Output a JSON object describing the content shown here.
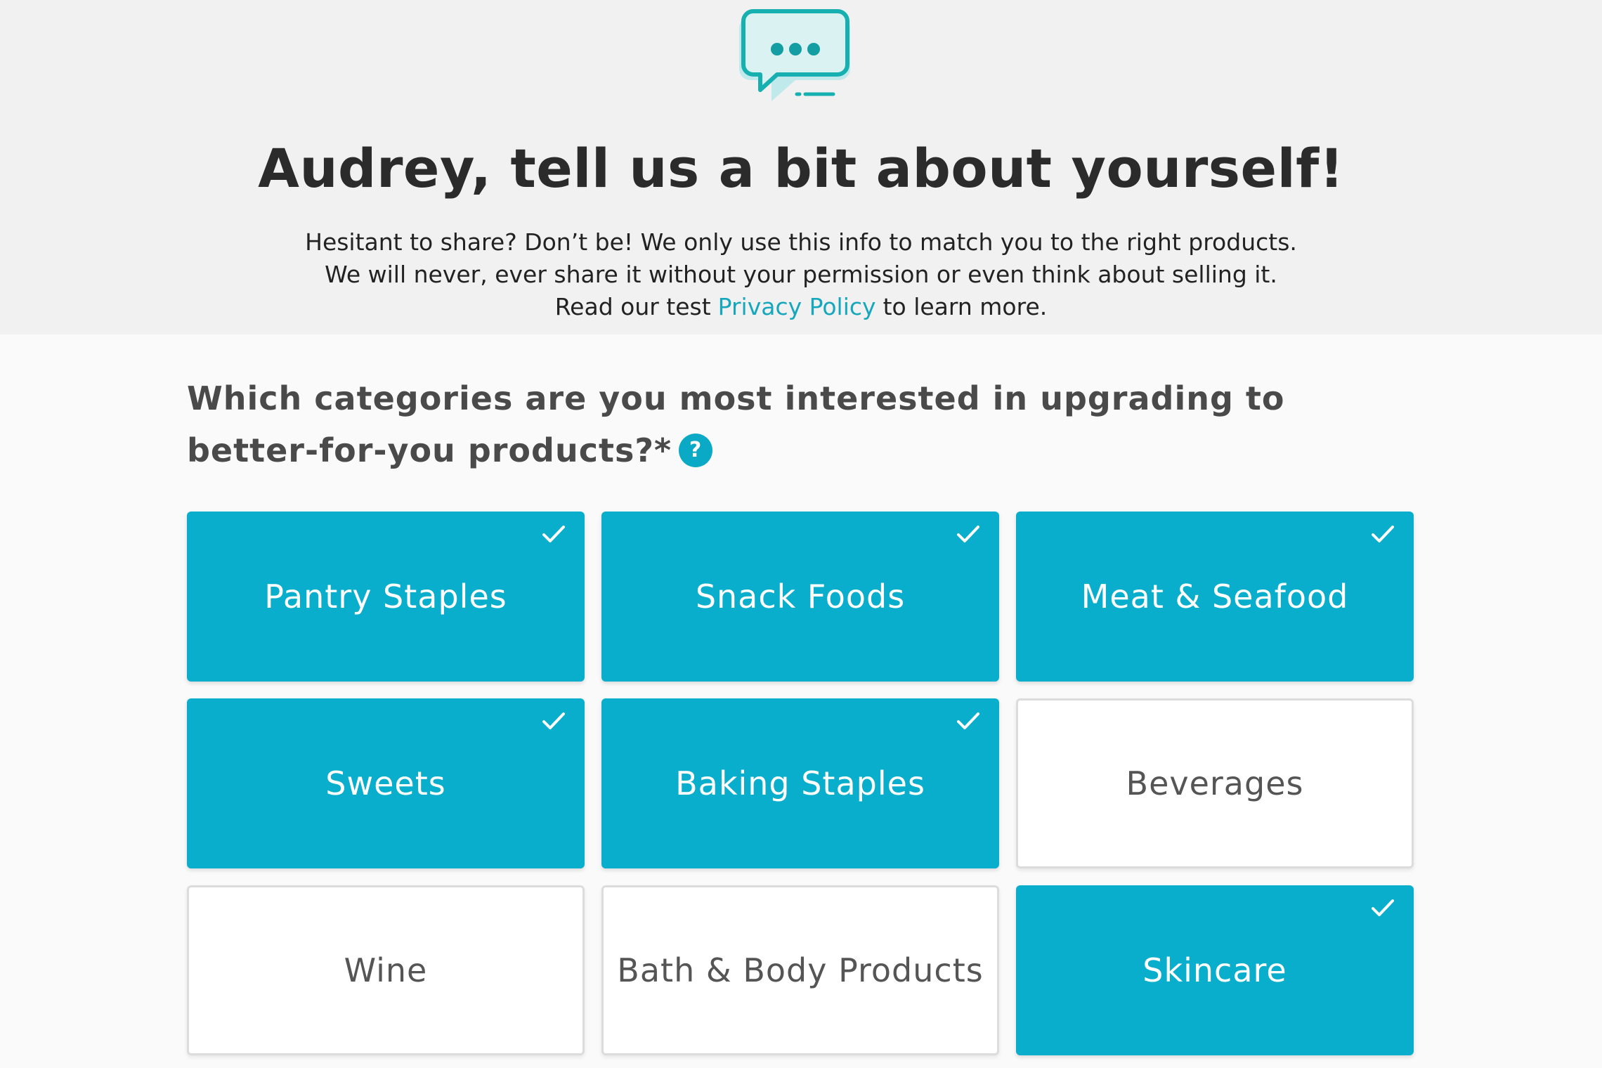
{
  "header": {
    "icon": "chat-bubble-icon",
    "title": "Audrey, tell us a bit about yourself!",
    "intro_line_1": "Hesitant to share? Don’t be! We only use this info to match you to the right products.",
    "intro_line_2": "We will never, ever share it without your permission or even think about selling it.",
    "intro_line_3_before": "Read our test",
    "privacy_link": "Privacy Policy",
    "intro_line_3_after": "to learn more."
  },
  "question": {
    "text": "Which categories are you most interested in upgrading to better-for-you products?*",
    "help_label": "?"
  },
  "categories": [
    {
      "label": "Pantry Staples",
      "selected": true
    },
    {
      "label": "Snack Foods",
      "selected": true
    },
    {
      "label": "Meat & Seafood",
      "selected": true
    },
    {
      "label": "Sweets",
      "selected": true
    },
    {
      "label": "Baking Staples",
      "selected": true
    },
    {
      "label": "Beverages",
      "selected": false
    },
    {
      "label": "Wine",
      "selected": false
    },
    {
      "label": "Bath & Body Products",
      "selected": false
    },
    {
      "label": "Skincare",
      "selected": true
    }
  ],
  "colors": {
    "accent": "#08aecb",
    "link": "#16a7bd",
    "heading": "#2b2b2b",
    "header_band": "#f1f1f1"
  }
}
